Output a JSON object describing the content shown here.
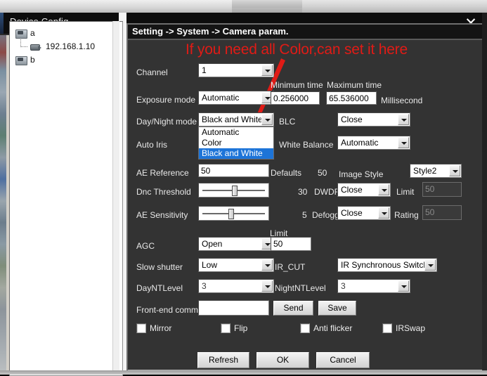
{
  "window": {
    "title": "Device Config",
    "close_icon": "close-icon"
  },
  "tree": {
    "nodes": [
      {
        "label": "a",
        "icon": "folder-icon"
      },
      {
        "label": "192.168.1.10",
        "icon": "camera-icon"
      },
      {
        "label": "b",
        "icon": "folder-icon"
      }
    ]
  },
  "panel": {
    "breadcrumb": "Setting -> System -> Camera param.",
    "annotation": "If you need all Color,can set it here",
    "annotation_color": "#e01b16"
  },
  "form": {
    "channel": {
      "label": "Channel",
      "value": "1"
    },
    "exposure_mode": {
      "label": "Exposure mode",
      "value": "Automatic"
    },
    "minimum_time": {
      "label": "Minimum time",
      "value": "0.256000"
    },
    "maximum_time": {
      "label": "Maximum time",
      "value": "65.536000"
    },
    "millisecond": {
      "label": "Millisecond"
    },
    "day_night_mode": {
      "label": "Day/Night mode",
      "value": "Black and White",
      "open": true,
      "options": [
        "Automatic",
        "Color",
        "Black and White"
      ],
      "selected_index": 2,
      "highlight_color": "#1d74d8"
    },
    "blc": {
      "label": "BLC",
      "value": "Close"
    },
    "auto_iris": {
      "label": "Auto Iris"
    },
    "white_balance": {
      "label": "White Balance",
      "value": "Automatic"
    },
    "ae_reference": {
      "label": "AE Reference",
      "value": "50"
    },
    "defaults": {
      "label": "Defaults",
      "value": "50"
    },
    "image_style": {
      "label": "Image Style",
      "value": "Style2"
    },
    "dnc_threshold": {
      "label": "Dnc Threshold",
      "value": "30",
      "percent": 50
    },
    "dwdr": {
      "label": "DWDR",
      "value": "Close"
    },
    "limit_dwdr": {
      "label": "Limit",
      "value": "50",
      "disabled": true
    },
    "ae_sensitivity": {
      "label": "AE Sensitivity",
      "value": "5",
      "percent": 45
    },
    "defogging": {
      "label": "Defogging",
      "value": "Close"
    },
    "rating": {
      "label": "Rating",
      "value": "50",
      "disabled": true
    },
    "agc": {
      "label": "AGC",
      "value": "Open"
    },
    "agc_limit": {
      "label": "Limit",
      "value": "50"
    },
    "slow_shutter": {
      "label": "Slow shutter",
      "value": "Low"
    },
    "ir_cut": {
      "label": "IR_CUT",
      "value": "IR Synchronous Switch"
    },
    "day_nt_level": {
      "label": "DayNTLevel",
      "value": "3"
    },
    "night_nt_level": {
      "label": "NightNTLevel",
      "value": "3"
    },
    "front_end_comm": {
      "label": "Front-end comm:",
      "value": "",
      "placeholder": ""
    },
    "send_button": "Send",
    "save_button": "Save"
  },
  "checkboxes": [
    {
      "label": "Mirror",
      "checked": false
    },
    {
      "label": "Flip",
      "checked": false
    },
    {
      "label": "Anti flicker",
      "checked": false
    },
    {
      "label": "IRSwap",
      "checked": false
    }
  ],
  "buttons": {
    "refresh": "Refresh",
    "ok": "OK",
    "cancel": "Cancel"
  }
}
